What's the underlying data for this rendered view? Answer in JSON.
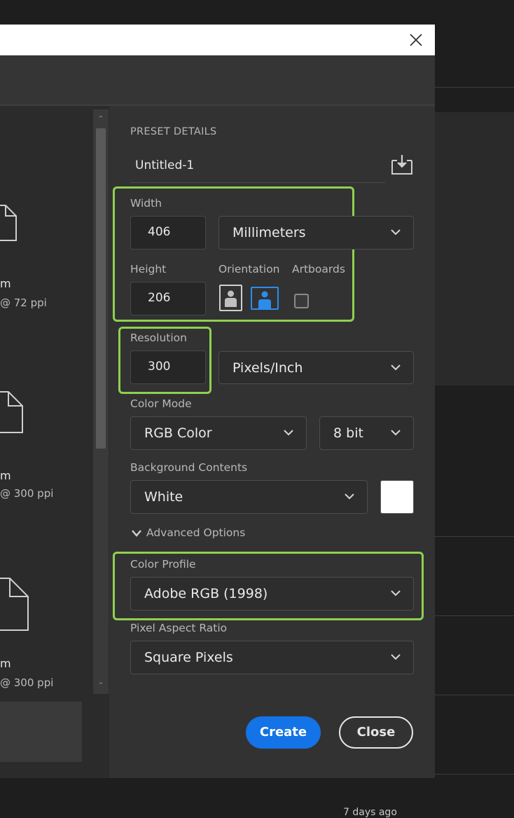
{
  "dialog": {
    "close_icon": "close-icon",
    "presets": [
      {
        "size_label": "m",
        "detail": "@ 72 ppi"
      },
      {
        "size_label": "m",
        "detail": "@ 300 ppi"
      },
      {
        "size_label": "m",
        "detail": "@ 300 ppi"
      }
    ],
    "preset_details": {
      "heading": "PRESET DETAILS",
      "name_value": "Untitled-1",
      "save_preset_icon": "save-preset-icon"
    },
    "width": {
      "label": "Width",
      "value": "406",
      "unit": "Millimeters"
    },
    "height": {
      "label": "Height",
      "value": "206"
    },
    "orientation": {
      "label": "Orientation",
      "selected": "landscape"
    },
    "artboards": {
      "label": "Artboards",
      "checked": false
    },
    "resolution": {
      "label": "Resolution",
      "value": "300",
      "unit": "Pixels/Inch"
    },
    "color_mode": {
      "label": "Color Mode",
      "mode": "RGB Color",
      "depth": "8 bit"
    },
    "background_contents": {
      "label": "Background Contents",
      "value": "White",
      "swatch": "#ffffff"
    },
    "advanced_options": {
      "label": "Advanced Options"
    },
    "color_profile": {
      "label": "Color Profile",
      "value": "Adobe RGB (1998)"
    },
    "pixel_aspect_ratio": {
      "label": "Pixel Aspect Ratio",
      "value": "Square Pixels"
    },
    "buttons": {
      "create": "Create",
      "close": "Close"
    }
  },
  "background": {
    "timestamp": "7 days ago"
  },
  "colors": {
    "accent": "#1473e6",
    "highlight": "#8fd14f",
    "panel": "#323232"
  }
}
